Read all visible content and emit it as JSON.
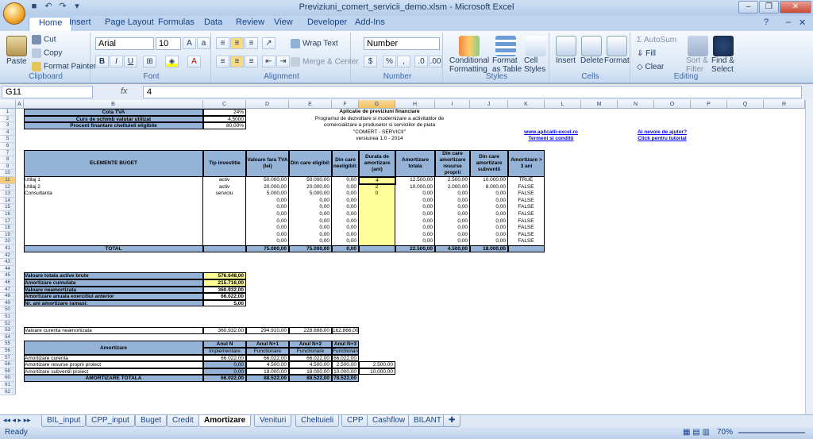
{
  "window": {
    "title": "Previziuni_comert_servicii_demo.xlsm - Microsoft Excel"
  },
  "ribbon_tabs": [
    "Home",
    "Insert",
    "Page Layout",
    "Formulas",
    "Data",
    "Review",
    "View",
    "Developer",
    "Add-Ins"
  ],
  "ribbon": {
    "clipboard": {
      "paste": "Paste",
      "cut": "Cut",
      "copy": "Copy",
      "format_painter": "Format Painter",
      "label": "Clipboard"
    },
    "font": {
      "name": "Arial",
      "size": "10",
      "label": "Font"
    },
    "alignment": {
      "wrap": "Wrap Text",
      "merge": "Merge & Center",
      "label": "Alignment"
    },
    "number": {
      "format": "Number",
      "label": "Number"
    },
    "styles": {
      "conditional": "Conditional",
      "conditional2": "Formatting",
      "format_table": "Format",
      "format_table2": "as Table",
      "cell_styles": "Cell",
      "cell_styles2": "Styles",
      "label": "Styles"
    },
    "cells": {
      "insert": "Insert",
      "delete": "Delete",
      "format": "Format",
      "label": "Cells"
    },
    "editing": {
      "autosum": "AutoSum",
      "fill": "Fill",
      "clear": "Clear",
      "sort": "Sort &",
      "sort2": "Filter",
      "find": "Find &",
      "find2": "Select",
      "label": "Editing"
    }
  },
  "formula_bar": {
    "cell": "G11",
    "fx": "fx",
    "value": "4"
  },
  "columns": [
    "A",
    "B",
    "C",
    "D",
    "E",
    "F",
    "G",
    "H",
    "I",
    "J",
    "K",
    "L",
    "M",
    "N",
    "O",
    "P",
    "Q",
    "R"
  ],
  "rows": [
    "1",
    "2",
    "3",
    "4",
    "5",
    "6",
    "7",
    "8",
    "9",
    "10",
    "11",
    "12",
    "13",
    "14",
    "15",
    "16",
    "17",
    "18",
    "19",
    "20",
    "41",
    "42",
    "43",
    "44",
    "45",
    "46",
    "47",
    "48",
    "49",
    "50",
    "51",
    "52",
    "53",
    "54",
    "55",
    "56",
    "57",
    "58",
    "59",
    "60",
    "61",
    "62"
  ],
  "sheet": {
    "top": {
      "cota_tva_l": "Cota TVA",
      "cota_tva_v": "24%",
      "curs_l": "Curs de schimb valutar utilizat",
      "curs_v": "4,5000",
      "procent_l": "Procent finantare cheltuieli eligibile",
      "procent_v": "80,00%",
      "app_title": "Aplicatie de previziuni financiare",
      "app_sub1": "Programul de dezvoltare si modernizare a activitatilor de",
      "app_sub2": "comercializare a produselor si serviciilor de piata",
      "app_sub3": "\"COMERT - SERVICII\"",
      "app_ver": "versiunea 1.0 - 2014",
      "link1": "www.aplicatii-excel.ro",
      "link2": "Termeni si conditii",
      "link3": "Ai nevoie de ajutor?",
      "link4": "Click pentru tutorial"
    },
    "headers": [
      "ELEMENTE BUGET",
      "Tip investitie",
      "Valoare fara TVA (lei)",
      "Din care eligibil:",
      "Din care neeligibil:",
      "Durata de amortizare (ani)",
      "Amortizare totala",
      "Din care amortizare resurse proprii",
      "Din care amortizare subventii",
      "Amortizare > 3 ani"
    ],
    "rows": [
      [
        "Utilaj 1",
        "activ",
        "50.000,00",
        "50.000,00",
        "0,00",
        "4",
        "12.500,00",
        "2.500,00",
        "10.000,00",
        "TRUE"
      ],
      [
        "Utilaj 2",
        "activ",
        "20.000,00",
        "20.000,00",
        "0,00",
        "2",
        "10.000,00",
        "2.000,00",
        "8.000,00",
        "FALSE"
      ],
      [
        "Consultanta",
        "serviciu",
        "5.000,00",
        "5.000,00",
        "0,00",
        "0",
        "0,00",
        "0,00",
        "0,00",
        "FALSE"
      ],
      [
        "",
        "",
        "0,00",
        "0,00",
        "0,00",
        "",
        "0,00",
        "0,00",
        "0,00",
        "FALSE"
      ],
      [
        "",
        "",
        "0,00",
        "0,00",
        "0,00",
        "",
        "0,00",
        "0,00",
        "0,00",
        "FALSE"
      ],
      [
        "",
        "",
        "0,00",
        "0,00",
        "0,00",
        "",
        "0,00",
        "0,00",
        "0,00",
        "FALSE"
      ],
      [
        "",
        "",
        "0,00",
        "0,00",
        "0,00",
        "",
        "0,00",
        "0,00",
        "0,00",
        "FALSE"
      ],
      [
        "",
        "",
        "0,00",
        "0,00",
        "0,00",
        "",
        "0,00",
        "0,00",
        "0,00",
        "FALSE"
      ],
      [
        "",
        "",
        "0,00",
        "0,00",
        "0,00",
        "",
        "0,00",
        "0,00",
        "0,00",
        "FALSE"
      ],
      [
        "",
        "",
        "0,00",
        "0,00",
        "0,00",
        "",
        "0,00",
        "0,00",
        "0,00",
        "FALSE"
      ]
    ],
    "total": [
      "TOTAL",
      "",
      "75.000,00",
      "75.000,00",
      "0,00",
      "",
      "22.500,00",
      "4.500,00",
      "18.000,00",
      ""
    ],
    "summary": [
      [
        "Valoare totala active brute",
        "576.648,00"
      ],
      [
        "Amortizare cumulata",
        "215.716,00"
      ],
      [
        "Valoare neamortizata",
        "360.932,00"
      ],
      [
        "Amortizare anuala exercitiul anterior",
        "66.022,00"
      ],
      [
        "Nr. ani amortizare ramasi:",
        "5,00"
      ]
    ],
    "curenta": [
      "Valoare curenta neamortizata",
      "360.932,00",
      "294.910,00",
      "228.888,00",
      "162.866,00"
    ],
    "amort_header": [
      "Amortizare",
      "Anul N",
      "Anul N+1",
      "Anul N+2",
      "Anul N+3"
    ],
    "amort_sub": [
      "Implementare",
      "Functionare",
      "Functionare",
      "Functionare"
    ],
    "amort_rows": [
      [
        "Amortizare curenta",
        "66.022,00",
        "66.022,00",
        "66.022,00",
        "66.022,00",
        ""
      ],
      [
        "Amortizare resurse proprii proiect",
        "0,00",
        "4.500,00",
        "4.500,00",
        "2.500,00",
        "2.500,00"
      ],
      [
        "Amortizare subventii proiect",
        "0,00",
        "18.000,00",
        "18.000,00",
        "10.000,00",
        "10.000,00"
      ],
      [
        "AMORTIZARE TOTALA",
        "66.022,00",
        "88.522,00",
        "88.522,00",
        "78.522,00",
        ""
      ]
    ]
  },
  "sheet_tabs": [
    "BIL_input",
    "CPP_input",
    "Buget",
    "Credit",
    "Amortizare",
    "Venituri",
    "Cheltuieli",
    "CPP",
    "Cashflow",
    "BILANT"
  ],
  "active_sheet": "Amortizare",
  "status": {
    "ready": "Ready",
    "zoom": "70%"
  }
}
